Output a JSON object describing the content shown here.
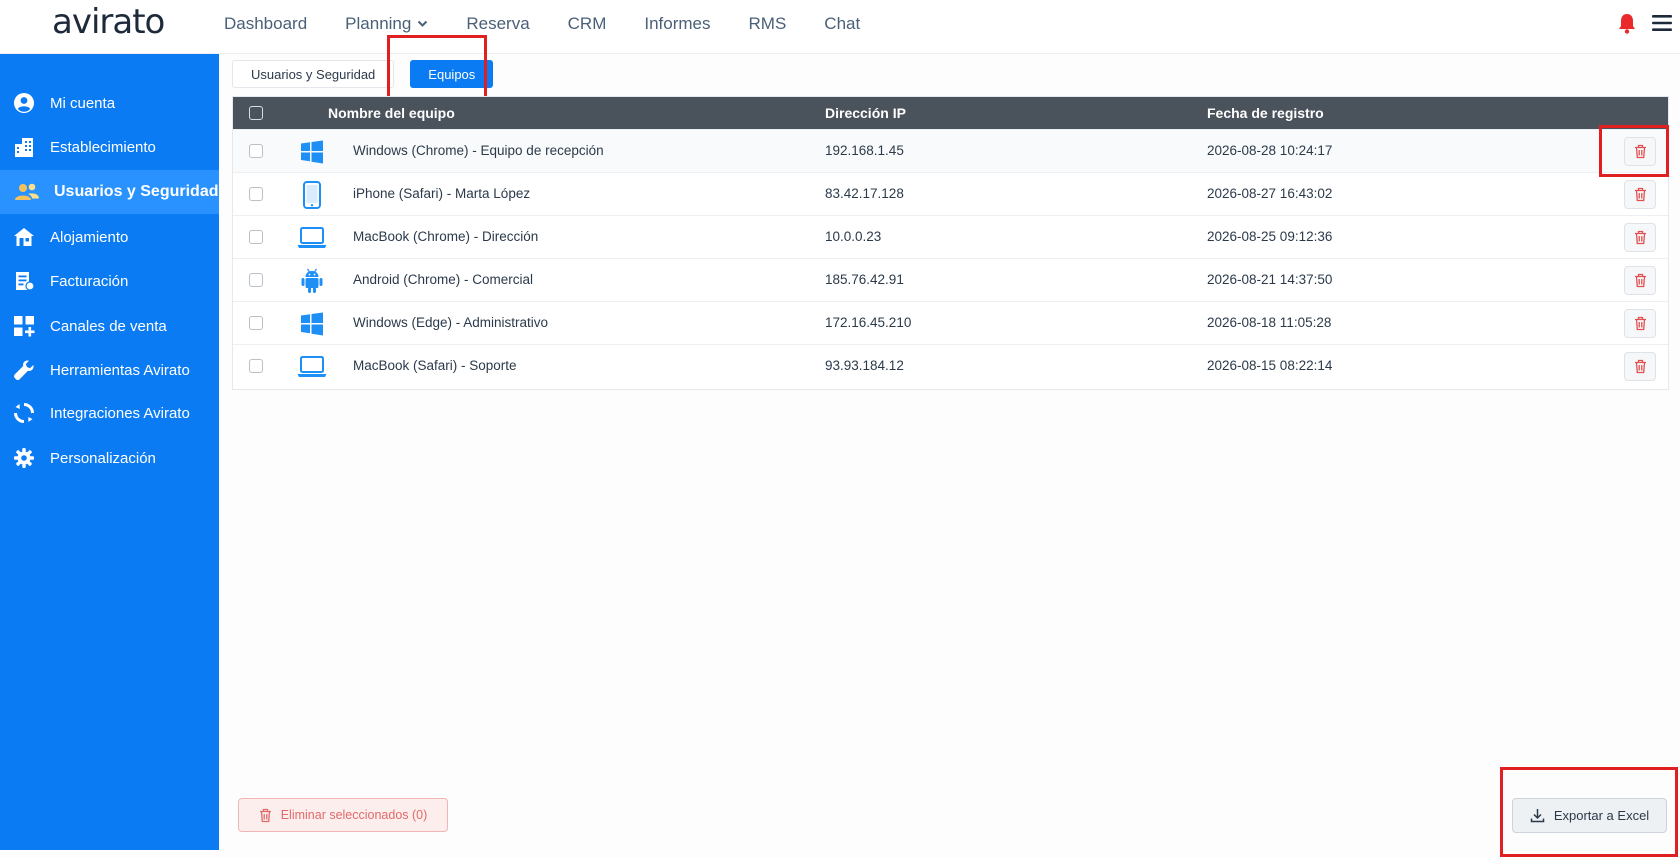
{
  "app": {
    "logo_text": "avirato"
  },
  "topnav": {
    "items": [
      {
        "label": "Dashboard"
      },
      {
        "label": "Planning"
      },
      {
        "label": "Reserva"
      },
      {
        "label": "CRM"
      },
      {
        "label": "Informes"
      },
      {
        "label": "RMS"
      },
      {
        "label": "Chat"
      }
    ]
  },
  "sidebar": {
    "items": [
      {
        "label": "Mi cuenta",
        "icon": "user-circle-icon"
      },
      {
        "label": "Establecimiento",
        "icon": "building-icon"
      },
      {
        "label": "Usuarios y Seguridad",
        "icon": "users-icon",
        "active": true
      },
      {
        "label": "Alojamiento",
        "icon": "house-icon"
      },
      {
        "label": "Facturación",
        "icon": "invoice-icon"
      },
      {
        "label": "Canales de venta",
        "icon": "grid-plus-icon"
      },
      {
        "label": "Herramientas Avirato",
        "icon": "wrench-icon"
      },
      {
        "label": "Integraciones Avirato",
        "icon": "sync-icon"
      },
      {
        "label": "Personalización",
        "icon": "gear-icon"
      }
    ]
  },
  "tabs": [
    {
      "label": "Usuarios y Seguridad",
      "active": false
    },
    {
      "label": "Equipos",
      "active": true
    }
  ],
  "table": {
    "headers": {
      "name": "Nombre del equipo",
      "ip": "Dirección IP",
      "date": "Fecha de registro"
    },
    "rows": [
      {
        "device": "windows",
        "name": "Windows (Chrome) - Equipo de recepción",
        "ip": "192.168.1.45",
        "date": "2026-08-28 10:24:17"
      },
      {
        "device": "phone",
        "name": "iPhone (Safari) - Marta López",
        "ip": "83.42.17.128",
        "date": "2026-08-27 16:43:02"
      },
      {
        "device": "laptop",
        "name": "MacBook (Chrome) - Dirección",
        "ip": "10.0.0.23",
        "date": "2026-08-25 09:12:36"
      },
      {
        "device": "android",
        "name": "Android (Chrome) - Comercial",
        "ip": "185.76.42.91",
        "date": "2026-08-21 14:37:50"
      },
      {
        "device": "windows",
        "name": "Windows (Edge) - Administrativo",
        "ip": "172.16.45.210",
        "date": "2026-08-18 11:05:28"
      },
      {
        "device": "laptop",
        "name": "MacBook (Safari) - Soporte",
        "ip": "93.93.184.12",
        "date": "2026-08-15 08:22:14"
      }
    ]
  },
  "footer": {
    "delete_selected_label": "Eliminar seleccionados (0)",
    "export_label": "Exportar a Excel"
  },
  "colors": {
    "primary": "#0b7bf3",
    "header": "#4a525c",
    "danger": "#e05050",
    "highlight": "#e02020"
  }
}
